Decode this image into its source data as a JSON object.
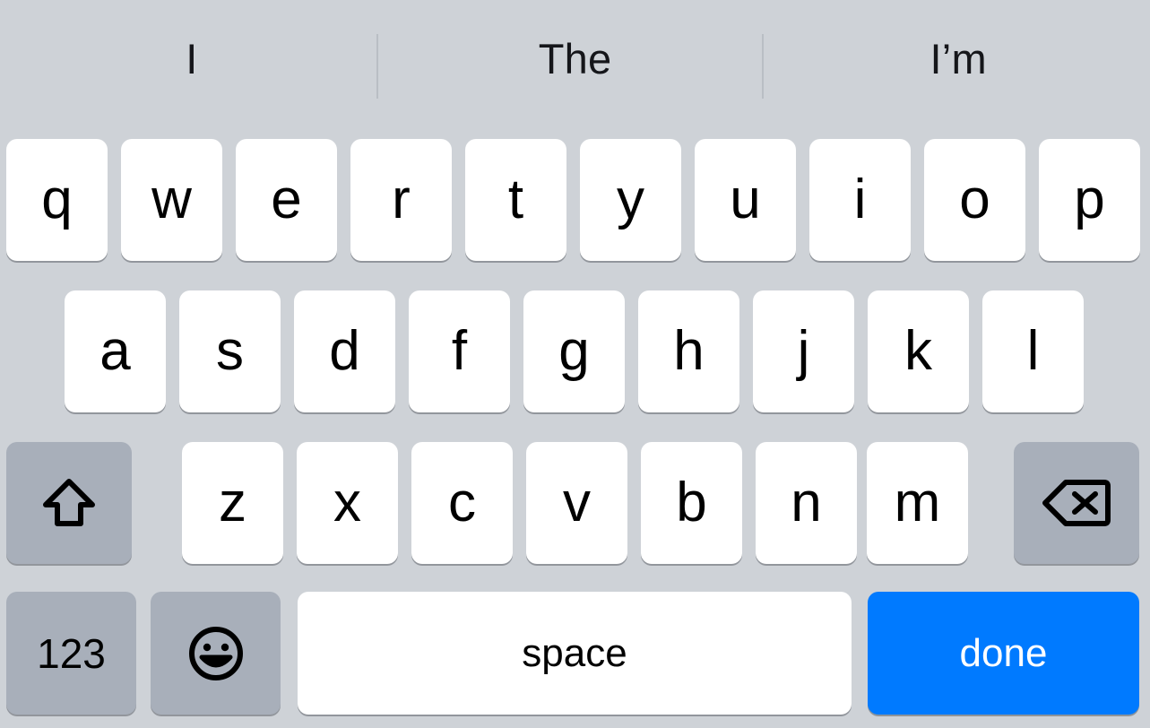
{
  "keyboard": {
    "layout_name": "ios-qwerty-lowercase",
    "background_color": "#ced2d7",
    "key_color": "#ffffff",
    "modifier_key_color": "#a8afba",
    "accent_color": "#007aff",
    "text_color": "#000000"
  },
  "suggestion_bar": {
    "items": [
      {
        "label": "I"
      },
      {
        "label": "The"
      },
      {
        "label": "I’m"
      }
    ]
  },
  "rows": {
    "row1": [
      {
        "label": "q"
      },
      {
        "label": "w"
      },
      {
        "label": "e"
      },
      {
        "label": "r"
      },
      {
        "label": "t"
      },
      {
        "label": "y"
      },
      {
        "label": "u"
      },
      {
        "label": "i"
      },
      {
        "label": "o"
      },
      {
        "label": "p"
      }
    ],
    "row2": [
      {
        "label": "a"
      },
      {
        "label": "s"
      },
      {
        "label": "d"
      },
      {
        "label": "f"
      },
      {
        "label": "g"
      },
      {
        "label": "h"
      },
      {
        "label": "j"
      },
      {
        "label": "k"
      },
      {
        "label": "l"
      }
    ],
    "row3": [
      {
        "label": "z"
      },
      {
        "label": "x"
      },
      {
        "label": "c"
      },
      {
        "label": "v"
      },
      {
        "label": "b"
      },
      {
        "label": "n"
      },
      {
        "label": "m"
      }
    ]
  },
  "special_keys": {
    "shift": {
      "icon": "shift-arrow-icon",
      "label": ""
    },
    "backspace": {
      "icon": "delete-backward-icon",
      "label": ""
    },
    "numbers": {
      "label": "123"
    },
    "emoji": {
      "icon": "smiley-face-icon",
      "label": ""
    },
    "space": {
      "label": "space"
    },
    "done": {
      "label": "done"
    }
  }
}
